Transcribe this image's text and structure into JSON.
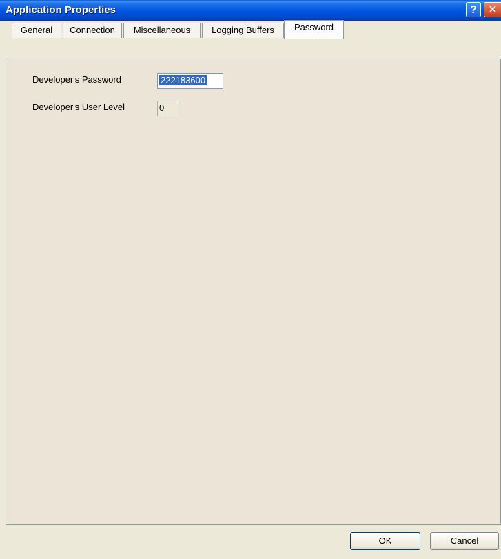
{
  "window": {
    "title": "Application Properties"
  },
  "titlebar_buttons": {
    "help": "?",
    "close": "✕"
  },
  "tabs": [
    {
      "label": "General"
    },
    {
      "label": "Connection"
    },
    {
      "label": "Miscellaneous"
    },
    {
      "label": "Logging Buffers"
    },
    {
      "label": "Password"
    }
  ],
  "password_tab": {
    "password_label": "Developer's Password",
    "password_value": "222183600",
    "user_level_label": "Developer's User Level",
    "user_level_value": "0"
  },
  "buttons": {
    "ok": "OK",
    "cancel": "Cancel"
  }
}
